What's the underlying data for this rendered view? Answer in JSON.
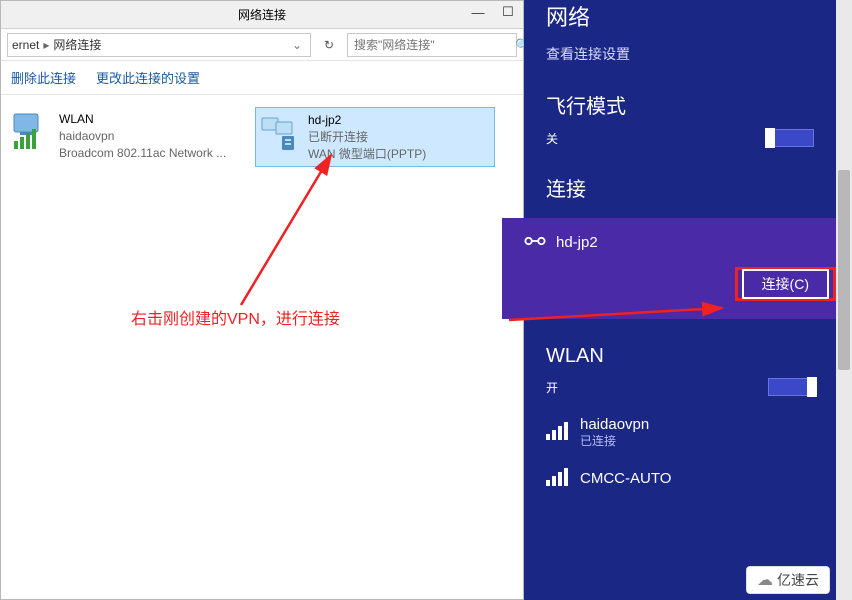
{
  "explorer": {
    "title": "网络连接",
    "window_buttons": {
      "min": "—",
      "max": "☐"
    },
    "breadcrumb": {
      "part1": "ernet",
      "part2": "网络连接"
    },
    "refresh_glyph": "↻",
    "search": {
      "placeholder": "搜索\"网络连接\"",
      "icon": "🔍"
    },
    "commands": {
      "delete": "删除此连接",
      "settings": "更改此连接的设置"
    },
    "items": [
      {
        "title": "WLAN",
        "line2": "haidaovpn",
        "line3": "Broadcom 802.11ac Network ...",
        "selected": false,
        "icon": "wifi"
      },
      {
        "title": "hd-jp2",
        "line2": "已断开连接",
        "line3": "WAN 微型端口(PPTP)",
        "selected": true,
        "icon": "vpn"
      }
    ],
    "annotation": "右击刚创建的VPN，进行连接"
  },
  "charm": {
    "header": "网络",
    "view_settings": "查看连接设置",
    "airplane": {
      "title": "飞行模式",
      "state": "关"
    },
    "connections": {
      "title": "连接",
      "vpn": {
        "name": "hd-jp2",
        "connect_label": "连接(C)"
      }
    },
    "wlan": {
      "title": "WLAN",
      "state": "开",
      "items": [
        {
          "name": "haidaovpn",
          "sub": "已连接"
        },
        {
          "name": "CMCC-AUTO",
          "sub": ""
        }
      ]
    }
  },
  "watermark": "亿速云"
}
